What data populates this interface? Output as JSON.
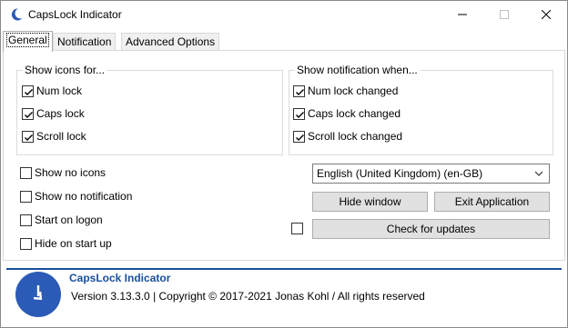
{
  "window": {
    "title": "CapsLock Indicator"
  },
  "tabs": [
    {
      "label": "General"
    },
    {
      "label": "Notification"
    },
    {
      "label": "Advanced Options"
    }
  ],
  "icons_group": {
    "label": "Show icons for...",
    "items": [
      {
        "label": "Num lock",
        "checked": true
      },
      {
        "label": "Caps lock",
        "checked": true
      },
      {
        "label": "Scroll lock",
        "checked": true
      }
    ]
  },
  "notification_group": {
    "label": "Show notification when...",
    "items": [
      {
        "label": "Num lock changed",
        "checked": true
      },
      {
        "label": "Caps lock changed",
        "checked": true
      },
      {
        "label": "Scroll lock changed",
        "checked": true
      }
    ]
  },
  "options": [
    {
      "label": "Show no icons",
      "checked": false
    },
    {
      "label": "Show no notification",
      "checked": false
    },
    {
      "label": "Start on logon",
      "checked": false
    },
    {
      "label": "Hide on start up",
      "checked": false
    }
  ],
  "language": {
    "selected": "English (United Kingdom) (en-GB)"
  },
  "buttons": {
    "hide_window": "Hide window",
    "exit_application": "Exit Application",
    "check_updates": "Check for updates"
  },
  "update_checkbox": {
    "checked": false
  },
  "footer": {
    "title": "CapsLock Indicator",
    "version": "Version 3.13.3.0 | Copyright © 2017-2021 Jonas Kohl / All rights reserved"
  },
  "colors": {
    "accent": "#1a4fa0",
    "logo_bg": "#2b5bb6"
  },
  "icon_names": [
    "app-moon-icon",
    "minimize-icon",
    "maximize-icon",
    "close-icon",
    "chevron-down-icon",
    "capslock-logo-icon",
    "checkmark-icon"
  ]
}
